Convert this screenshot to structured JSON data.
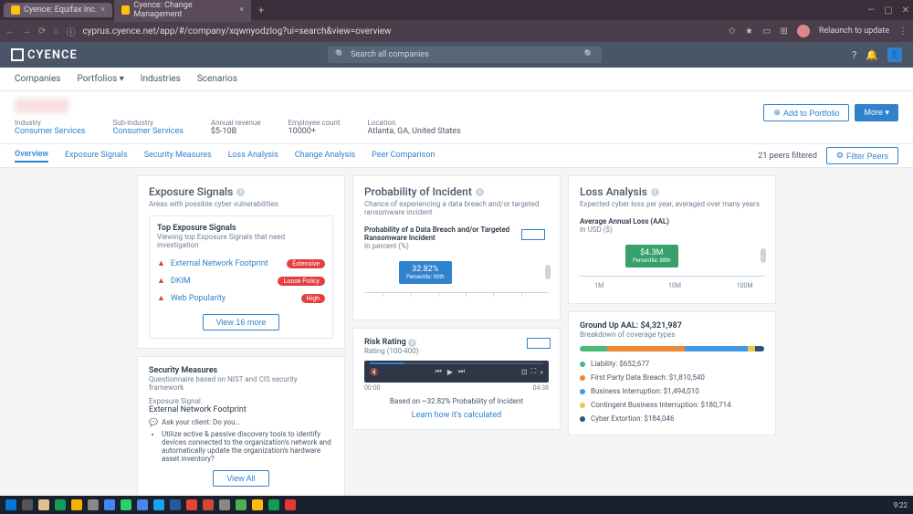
{
  "browser": {
    "tabs": [
      {
        "title": "Cyence: Equifax Inc."
      },
      {
        "title": "Cyence: Change Management"
      }
    ],
    "url": "cyprus.cyence.net/app/#/company/xqwnyodzlog?ui=search&view=overview",
    "relaunch": "Relaunch to update"
  },
  "app": {
    "brand": "CYENCE",
    "search_placeholder": "Search all companies",
    "nav": [
      "Companies",
      "Portfolios",
      "Industries",
      "Scenarios"
    ]
  },
  "company": {
    "meta": {
      "industry_label": "Industry",
      "industry": "Consumer Services",
      "sub_label": "Sub-industry",
      "sub": "Consumer Services",
      "revenue_label": "Annual revenue",
      "revenue": "$5-10B",
      "emp_label": "Employee count",
      "emp": "10000+",
      "loc_label": "Location",
      "loc": "Atlanta, GA, United States"
    },
    "add_portfolio": "Add to Portfolio",
    "more": "More"
  },
  "subtabs": [
    "Overview",
    "Exposure Signals",
    "Security Measures",
    "Loss Analysis",
    "Change Analysis",
    "Peer Comparison"
  ],
  "peers": {
    "count": "21 peers filtered",
    "filter": "Filter Peers"
  },
  "exposure": {
    "title": "Exposure Signals",
    "subtitle": "Areas with possible cyber vulnerabilities",
    "top": {
      "title": "Top Exposure Signals",
      "desc": "Viewing top Exposure Signals that need investigation",
      "items": [
        {
          "name": "External Network Footprint",
          "badge": "Extensive"
        },
        {
          "name": "DKIM",
          "badge": "Loose Policy"
        },
        {
          "name": "Web Popularity",
          "badge": "High"
        }
      ],
      "view": "View 16 more"
    },
    "measures": {
      "title": "Security Measures",
      "desc": "Questionnaire based on NIST and CIS security framework",
      "sig_label": "Exposure Signal",
      "sig": "External Network Footprint",
      "ask": "Ask your client: Do you…",
      "bullet": "Utilize active & passive discovery tools to identify devices connected to the organization's network and automatically update the organization's hardware asset inventory?",
      "view": "View All"
    }
  },
  "probability": {
    "title": "Probability of Incident",
    "subtitle": "Chance of experiencing a data breach and/or targeted ransomware incident",
    "chart_title": "Probability of a Data Breach and/or Targeted Ransomware Incident",
    "unit": "In percent (%)",
    "value": "32.82%",
    "percentile": "Percentile: 95th",
    "risk_title": "Risk Rating",
    "risk_range": "Rating (100-400)",
    "based": "Based on ~32.82% Probability of Incident",
    "learn": "Learn how it's calculated",
    "video": {
      "cur": "00:00",
      "total": "04:38"
    }
  },
  "loss": {
    "title": "Loss Analysis",
    "subtitle": "Expected cyber loss per year, averaged over many years",
    "aal_title": "Average Annual Loss (AAL)",
    "aal_unit": "In USD ($)",
    "value": "$4.3M",
    "percentile": "Percentile: 88th",
    "ticks": [
      "1M",
      "10M",
      "100M"
    ],
    "ground_title": "Ground Up AAL: $4,321,987",
    "ground_sub": "Breakdown of coverage types",
    "legend": [
      {
        "color": "#48bb78",
        "label": "Liability: $652,677"
      },
      {
        "color": "#ed8936",
        "label": "First Party Data Breach: $1,810,540"
      },
      {
        "color": "#4299e1",
        "label": "Business Interruption: $1,494,010"
      },
      {
        "color": "#ecc94b",
        "label": "Contingent Business Interruption: $180,714"
      },
      {
        "color": "#2c5282",
        "label": "Cyber Extortion: $184,046"
      }
    ]
  },
  "clock": "9:22"
}
